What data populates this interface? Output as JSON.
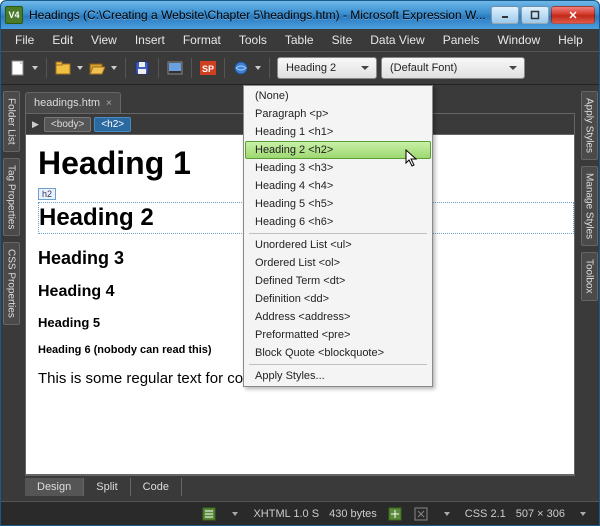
{
  "titlebar": {
    "app_icon_text": "V4",
    "title": "Headings (C:\\Creating a Website\\Chapter 5\\headings.htm) - Microsoft Expression W..."
  },
  "menubar": [
    "File",
    "Edit",
    "View",
    "Insert",
    "Format",
    "Tools",
    "Table",
    "Site",
    "Data View",
    "Panels",
    "Window",
    "Help"
  ],
  "toolbar": {
    "style_value": "Heading 2",
    "font_value": "(Default Font)"
  },
  "leftTabs": [
    "Folder List",
    "Tag Properties",
    "CSS Properties"
  ],
  "rightTabs": [
    "Apply Styles",
    "Manage Styles",
    "Toolbox"
  ],
  "docTab": {
    "label": "headings.htm",
    "close": "×"
  },
  "crumbs": {
    "body": "<body>",
    "h2": "<h2>"
  },
  "content": {
    "h1": "Heading 1",
    "h2tag": "h2",
    "h2": "Heading 2",
    "h3": "Heading 3",
    "h4": "Heading 4",
    "h5": "Heading 5",
    "h6": "Heading 6 (nobody can read this)",
    "para": "This is some regular text for comparison."
  },
  "viewtabs": {
    "design": "Design",
    "split": "Split",
    "code": "Code"
  },
  "status": {
    "doctype": "XHTML 1.0 S",
    "size": "430 bytes",
    "css": "CSS 2.1",
    "dims": "507 × 306"
  },
  "dropdown": {
    "items": [
      "(None)",
      "Paragraph <p>",
      "Heading 1 <h1>",
      "Heading 2 <h2>",
      "Heading 3 <h3>",
      "Heading 4 <h4>",
      "Heading 5 <h5>",
      "Heading 6 <h6>",
      "Unordered List <ul>",
      "Ordered List <ol>",
      "Defined Term <dt>",
      "Definition <dd>",
      "Address <address>",
      "Preformatted <pre>",
      "Block Quote <blockquote>",
      "Apply Styles..."
    ],
    "hover_index": 3
  }
}
